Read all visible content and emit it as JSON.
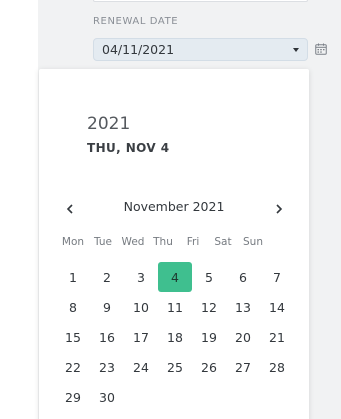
{
  "renewal": {
    "label": "RENEWAL DATE",
    "value": "04/11/2021"
  },
  "calendar": {
    "year": "2021",
    "selected_date_text": "THU, NOV 4",
    "month_title": "November 2021",
    "weekdays": [
      "Mon",
      "Tue",
      "Wed",
      "Thu",
      "Fri",
      "Sat",
      "Sun"
    ],
    "weeks": [
      [
        "1",
        "2",
        "3",
        "4",
        "5",
        "6",
        "7"
      ],
      [
        "8",
        "9",
        "10",
        "11",
        "12",
        "13",
        "14"
      ],
      [
        "15",
        "16",
        "17",
        "18",
        "19",
        "20",
        "21"
      ],
      [
        "22",
        "23",
        "24",
        "25",
        "26",
        "27",
        "28"
      ],
      [
        "29",
        "30",
        "",
        "",
        "",
        "",
        ""
      ]
    ],
    "selected_day": "4",
    "accent_color": "#3fbf8f"
  },
  "icons": {
    "dropdown": "caret-down-icon",
    "calendar": "calendar-icon",
    "prev": "chevron-left-icon",
    "next": "chevron-right-icon"
  }
}
